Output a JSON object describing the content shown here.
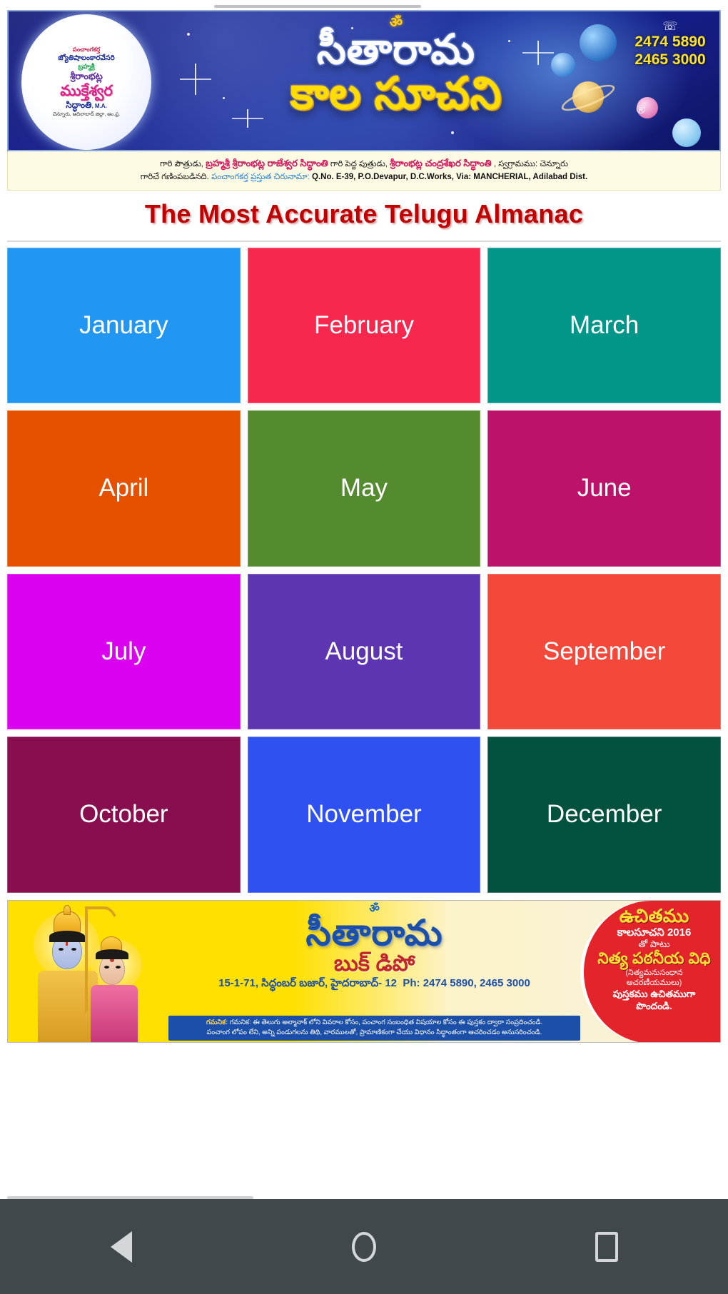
{
  "header": {
    "logo": {
      "line1": "పంచాంగకర్త",
      "line2": "జ్యోతిషాలంకారవేసరి",
      "line3": "బ్రహ్మశ్రీ",
      "line4": "శ్రీరాంభట్ల",
      "line5": "ముక్తేశ్వర",
      "line6": "సిద్ధాంతి",
      "line6_suffix": ", M.A.",
      "line7": "చెన్నూరు, ఆదిలాబాద్ జిల్లా, ఆం.ప్ర."
    },
    "om_symbol": "ॐ",
    "title_line1": "సీతారామ",
    "title_line2": "కాల సూచని",
    "registered_mark": "®",
    "phone_icon": "☏",
    "phone_numbers": [
      "2474 5890",
      "2465 3000"
    ]
  },
  "credits": {
    "line1_part1": "గారి పౌత్రుడు,",
    "line1_red1": "బ్రహ్మశ్రీ శ్రీరాంభట్ల రాజేశ్వర సిద్ధాంతి",
    "line1_part2": "గారి పెద్ద పుత్రుడు,",
    "line1_red2": "శ్రీరాంభట్ల చంద్రశేఖర సిద్ధాంతి",
    "line1_part3": ", స్వగ్రామము: చెన్నూరు",
    "line2_part1": "గారిచే గణింపబడినది.",
    "line2_blue": "పంచాంగకర్త ప్రస్తుత చిరునామా:",
    "line2_addr": "Q.No. E-39, P.O.Devapur, D.C.Works, Via: MANCHERIAL, Adilabad Dist."
  },
  "page_title": "The Most Accurate Telugu Almanac",
  "months": [
    {
      "label": "January",
      "color": "#2196f3"
    },
    {
      "label": "February",
      "color": "#f8274d"
    },
    {
      "label": "March",
      "color": "#029688"
    },
    {
      "label": "April",
      "color": "#e65100"
    },
    {
      "label": "May",
      "color": "#558b2f"
    },
    {
      "label": "June",
      "color": "#bd1269"
    },
    {
      "label": "July",
      "color": "#db00f0"
    },
    {
      "label": "August",
      "color": "#5e35b1"
    },
    {
      "label": "September",
      "color": "#f4483a"
    },
    {
      "label": "October",
      "color": "#880e4f"
    },
    {
      "label": "November",
      "color": "#2f51f2"
    },
    {
      "label": "December",
      "color": "#00513e"
    }
  ],
  "footer_ad": {
    "om_symbol": "ॐ",
    "brand": "సీతారామ",
    "subtitle": "బుక్ డిపో",
    "address": "15-1-71, సిద్ధంబర్ బజార్, హైదరాబాద్- 12",
    "phone_label": "Ph: 2474 5890, 2465 3000",
    "note_line1": "గమనిక: ఈ తెలుగు అల్మానాక్ లోని వివరాల కోసం, పంచాంగ సంబంధిత విషయాల కోసం ఈ పుస్తకం ద్వారా సంప్రదించండి.",
    "note_line2": "పంచాంగ లోపం లేని, అన్ని పండుగలను తిథి, వారములతో, ప్రామాణికంగా చేయు విధానం సిద్ధాంతంగా ఆచరించడం అనుసరించండి.",
    "note_label": "గమనిక:"
  },
  "promo": {
    "line1": "ఉచితము",
    "line2": "కాలసూచని 2016",
    "line3": "తో పాటు",
    "line4": "నిత్య పఠనీయ విధి",
    "line5a": "(నిత్యమనుసంధాన",
    "line5b": "ఆచరణీయములు)",
    "line6a": "పుస్తకము ఉచితముగా",
    "line6b": "పొందండి."
  },
  "nav_bar": {
    "back_label": "Back",
    "home_label": "Home",
    "recents_label": "Recents"
  },
  "colors": {
    "title_red": "#c00000",
    "banner_blue": "#141a86",
    "accent_yellow": "#ffdd00",
    "promo_red": "#e3242b",
    "navbar": "#41484c"
  }
}
